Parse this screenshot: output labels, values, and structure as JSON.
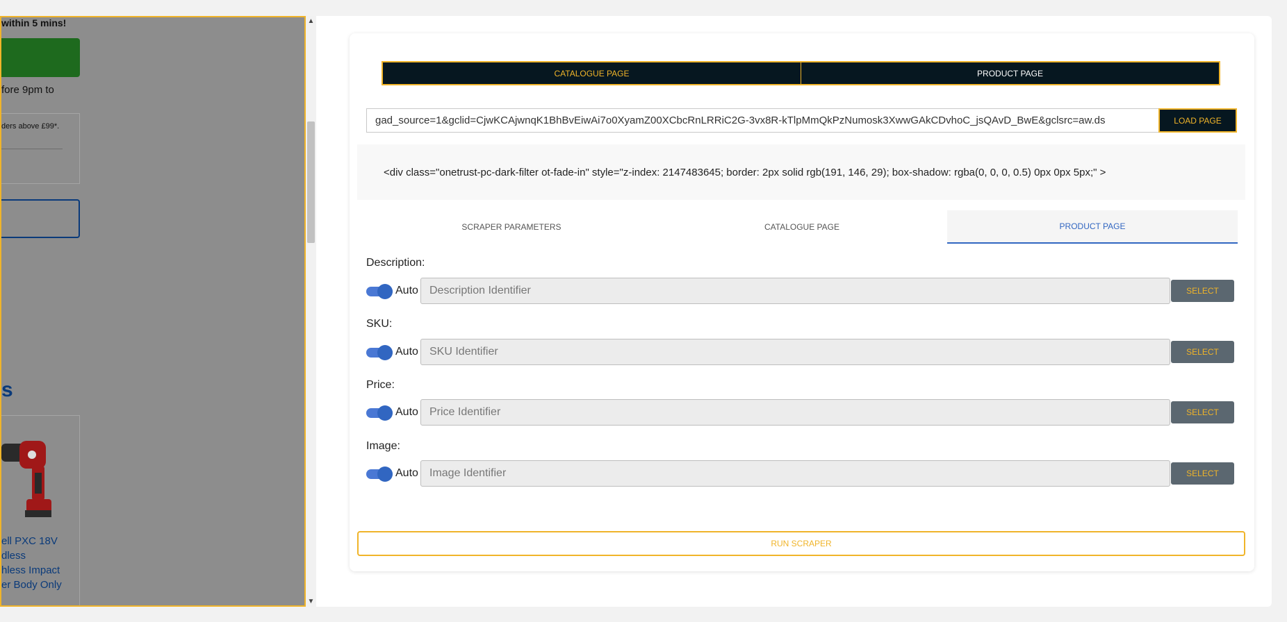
{
  "preview": {
    "delivery_text": "within 5 mins!",
    "fore_text": "fore 9pm to",
    "orders_text": "ders above £99*.",
    "section_heading": "s",
    "product_name": "ell PXC 18V dless hless Impact er Body Only",
    "product_name_lines": [
      "ell PXC 18V",
      "dless",
      "hless Impact",
      "er Body Only"
    ],
    "stars": "★★★"
  },
  "mode_tabs": [
    {
      "label": "CATALOGUE PAGE",
      "active": true
    },
    {
      "label": "PRODUCT PAGE",
      "active": false
    }
  ],
  "url_bar": {
    "value": "gad_source=1&gclid=CjwKCAjwnqK1BhBvEiwAi7o0XyamZ00XCbcRnLRRiC2G-3vx8R-kTlpMmQkPzNumosk3XwwGAkCDvhoC_jsQAvD_BwE&gclsrc=aw.ds",
    "load_label": "LOAD PAGE"
  },
  "selected_element": "<div class=\"onetrust-pc-dark-filter ot-fade-in\" style=\"z-index: 2147483645; border: 2px solid rgb(191, 146, 29); box-shadow: rgba(0, 0, 0, 0.5) 0px 0px 5px;\" >",
  "sub_tabs": [
    {
      "label": "SCRAPER PARAMETERS",
      "active": false
    },
    {
      "label": "CATALOGUE PAGE",
      "active": false
    },
    {
      "label": "PRODUCT PAGE",
      "active": true
    }
  ],
  "fields": [
    {
      "label": "Description:",
      "auto_label": "Auto",
      "auto": true,
      "placeholder": "Description Identifier",
      "select_label": "SELECT"
    },
    {
      "label": "SKU:",
      "auto_label": "Auto",
      "auto": true,
      "placeholder": "SKU Identifier",
      "select_label": "SELECT"
    },
    {
      "label": "Price:",
      "auto_label": "Auto",
      "auto": true,
      "placeholder": "Price Identifier",
      "select_label": "SELECT"
    },
    {
      "label": "Image:",
      "auto_label": "Auto",
      "auto": true,
      "placeholder": "Image Identifier",
      "select_label": "SELECT"
    }
  ],
  "run_label": "RUN SCRAPER",
  "colors": {
    "accent": "#f0b429",
    "dark": "#061720",
    "active_tab": "#3166c1",
    "select_btn": "#5b6770"
  }
}
